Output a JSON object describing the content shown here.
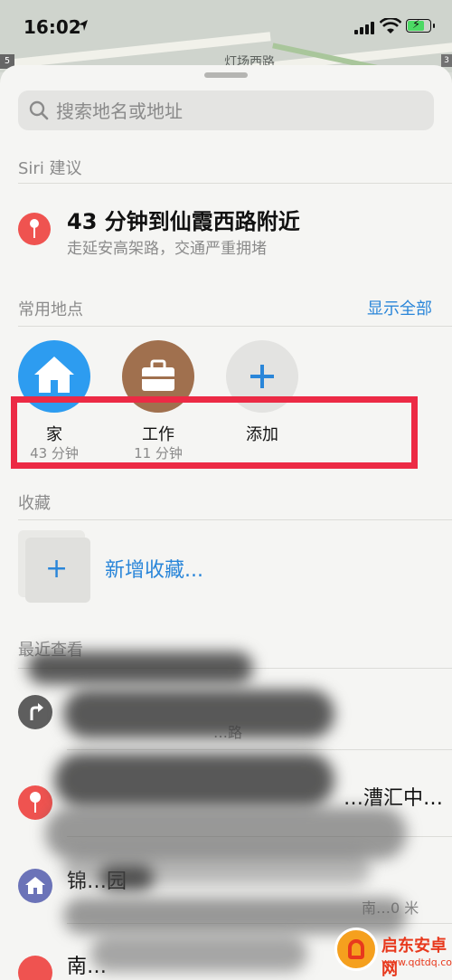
{
  "status": {
    "time": "16:02"
  },
  "map": {
    "road_label": "灯场西路",
    "badge_left": "5",
    "badge_right": "3"
  },
  "search": {
    "placeholder": "搜索地名或地址"
  },
  "siri": {
    "header": "Siri 建议",
    "title": "43 分钟到仙霞西路附近",
    "subtitle": "走延安高架路，交通严重拥堵"
  },
  "favorites": {
    "header": "常用地点",
    "show_all": "显示全部",
    "items": [
      {
        "label": "家",
        "sub": "43 分钟",
        "icon": "home-icon",
        "color": "#2d9cf0"
      },
      {
        "label": "工作",
        "sub": "11 分钟",
        "icon": "briefcase-icon",
        "color": "#a0704e"
      },
      {
        "label": "添加",
        "sub": "",
        "icon": "plus-icon",
        "color": "#e3e3e1"
      }
    ]
  },
  "collections": {
    "header": "收藏",
    "add_label": "新增收藏..."
  },
  "recents": {
    "header": "最近查看",
    "items": [
      {
        "icon": "directions-icon",
        "color": "#5e5e5e",
        "line1": "",
        "line2": "…路"
      },
      {
        "icon": "pin-icon",
        "color": "#ef5350",
        "line1": "…漕汇中…",
        "line2": ""
      },
      {
        "icon": "residence-icon",
        "color": "#6b73b8",
        "line1": "锦…园",
        "line2": "南…0 米"
      },
      {
        "icon": "pin-icon",
        "color": "#ef5350",
        "line1": "南…",
        "line2": ""
      }
    ]
  },
  "watermark": {
    "title": "启东安卓网",
    "url": "www.qdtdq.com"
  },
  "colors": {
    "accent": "#2a86d9",
    "highlight": "#ec2a45"
  }
}
